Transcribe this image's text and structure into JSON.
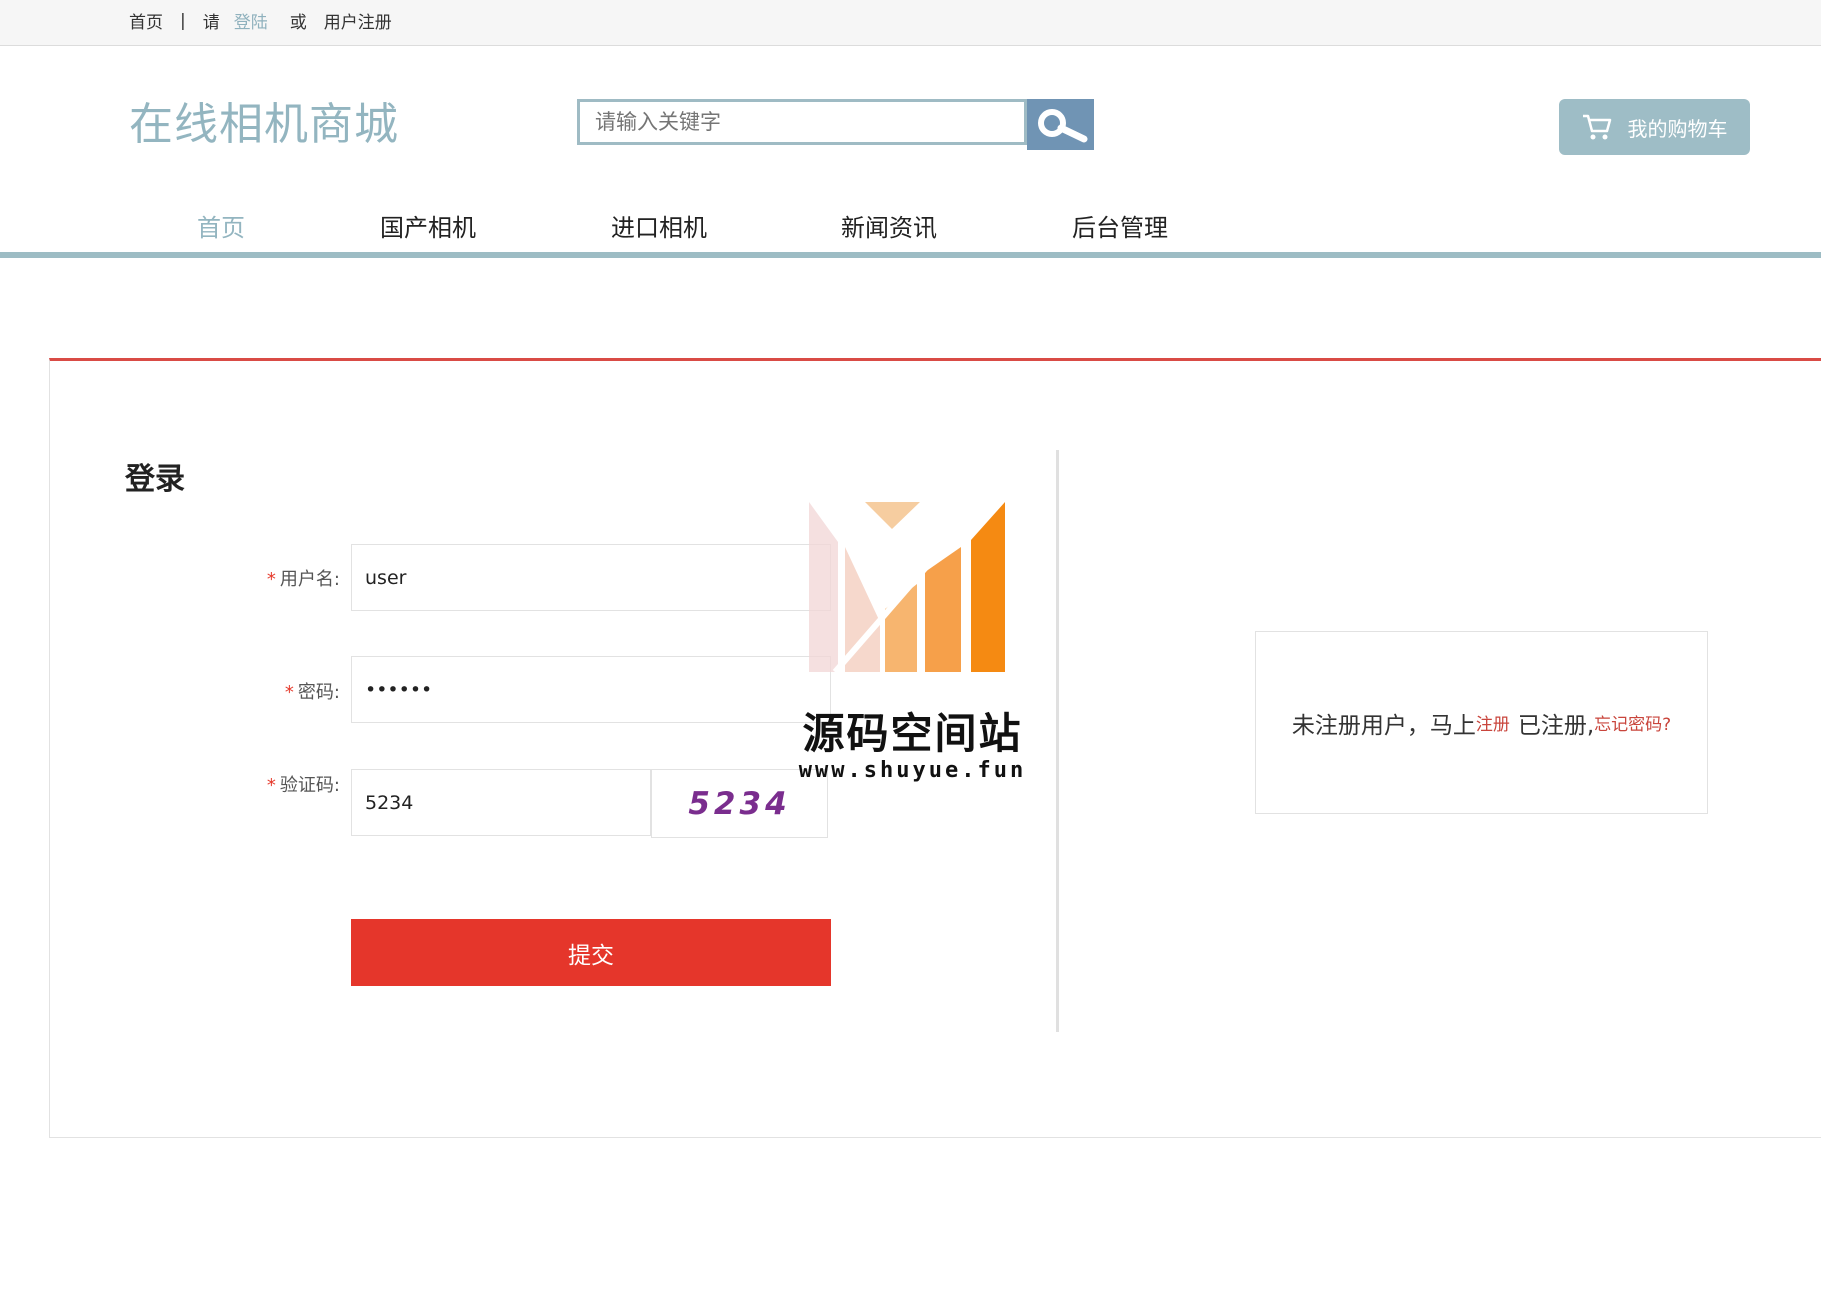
{
  "topbar": {
    "home": "首页",
    "separator": "|",
    "please": "请",
    "login": "登陆",
    "or": "或",
    "register": "用户注册"
  },
  "header": {
    "logo": "在线相机商城",
    "search_placeholder": "请输入关键字",
    "search_icon": "search-icon",
    "cart_label": "我的购物车",
    "cart_icon": "cart-icon"
  },
  "nav": {
    "items": [
      {
        "label": "首页",
        "active": true
      },
      {
        "label": "国产相机",
        "active": false
      },
      {
        "label": "进口相机",
        "active": false
      },
      {
        "label": "新闻资讯",
        "active": false
      },
      {
        "label": "后台管理",
        "active": false
      }
    ]
  },
  "login": {
    "title": "登录",
    "required_mark": "*",
    "username_label": "用户名:",
    "username_value": "user",
    "password_label": "密码:",
    "password_value": "••••••",
    "captcha_label": "验证码:",
    "captcha_value": "5234",
    "captcha_image_text": "5234",
    "submit": "提交"
  },
  "aside": {
    "text1": "未注册用户，马上",
    "register_link": "注册",
    "text2": "已注册,",
    "forgot_link": "忘记密码?"
  },
  "watermark": {
    "title": "源码空间站",
    "url": "www.shuyue.fun"
  },
  "colors": {
    "accent": "#93b5c0",
    "submit_red": "#e5362b",
    "search_button": "#7094b4"
  }
}
